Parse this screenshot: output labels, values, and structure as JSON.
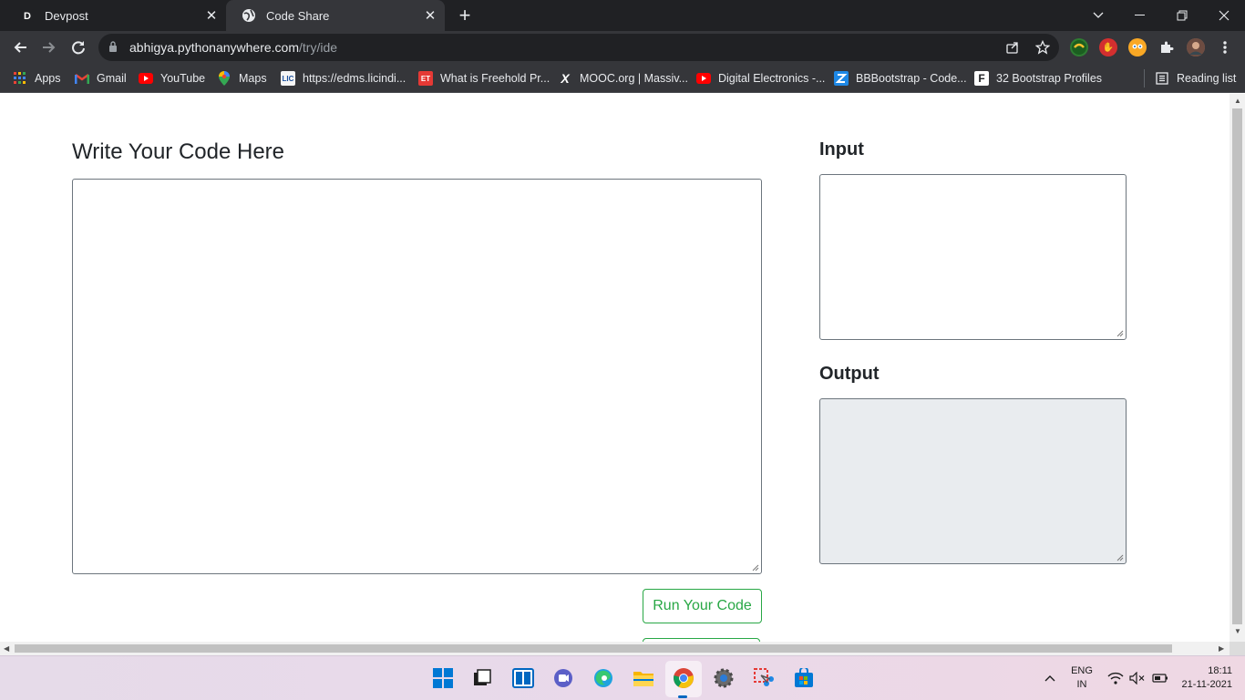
{
  "browser": {
    "tabs": [
      {
        "label": "Devpost",
        "favicon": "D"
      },
      {
        "label": "Code Share",
        "favicon": "globe-icon",
        "active": true
      }
    ],
    "url_host": "abhigya.pythonanywhere.com",
    "url_path": "/try/ide",
    "bookmarks": [
      {
        "label": "Apps",
        "icon": "apps-grid-icon"
      },
      {
        "label": "Gmail",
        "icon": "gmail-icon"
      },
      {
        "label": "YouTube",
        "icon": "youtube-icon"
      },
      {
        "label": "Maps",
        "icon": "maps-icon"
      },
      {
        "label": "https://edms.licindi...",
        "icon": "lic-icon"
      },
      {
        "label": "What is Freehold Pr...",
        "icon": "et-icon"
      },
      {
        "label": "MOOC.org | Massiv...",
        "icon": "x-icon"
      },
      {
        "label": "Digital Electronics -...",
        "icon": "youtube-icon"
      },
      {
        "label": "BBBootstrap - Code...",
        "icon": "bbbootstrap-icon"
      },
      {
        "label": "32 Bootstrap Profiles",
        "icon": "f-icon"
      }
    ],
    "reading_list": "Reading list"
  },
  "page": {
    "code_heading": "Write Your Code Here",
    "input_heading": "Input",
    "output_heading": "Output",
    "run_button": "Run Your Code"
  },
  "taskbar": {
    "lang_top": "ENG",
    "lang_bottom": "IN",
    "time": "18:11",
    "date": "21-11-2021"
  },
  "colors": {
    "success_green": "#28a745",
    "chrome_dark": "#202124",
    "chrome_toolbar": "#35363a",
    "readonly_bg": "#e9ecef"
  }
}
